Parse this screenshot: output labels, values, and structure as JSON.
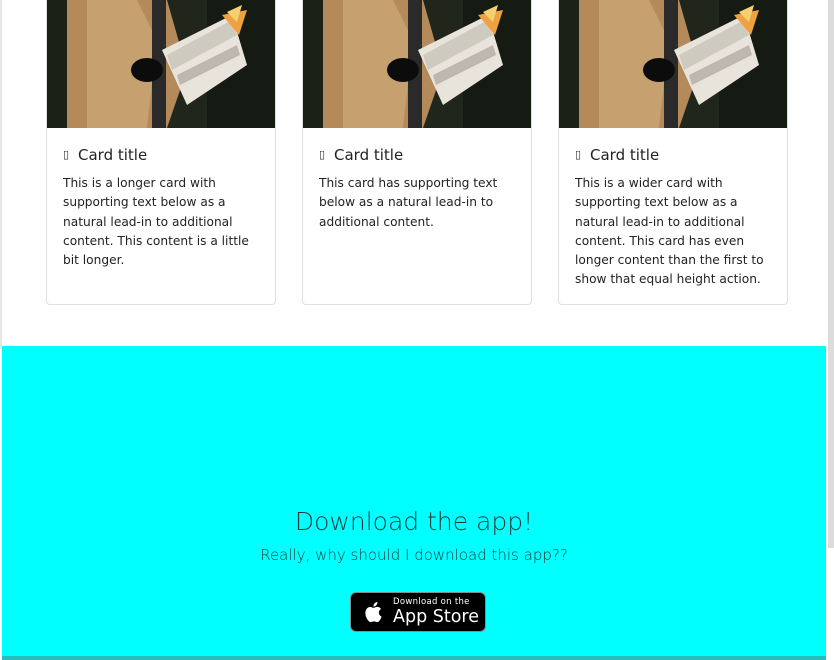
{
  "cards": [
    {
      "title": "Card title",
      "text": "This is a longer card with supporting text below as a natural lead-in to additional content. This content is a little bit longer."
    },
    {
      "title": "Card title",
      "text": "This card has supporting text below as a natural lead-in to additional content."
    },
    {
      "title": "Card title",
      "text": "This is a wider card with supporting text below as a natural lead-in to additional content. This card has even longer content than the first to show that equal height action."
    }
  ],
  "hero": {
    "title": "Download the app!",
    "subtitle": "Really, why should I download this app??",
    "button_small": "Download on the",
    "button_big": "App Store"
  },
  "colors": {
    "hero_background": "#00ffff",
    "button_background": "#000000"
  },
  "icons": {
    "card_title_icon": "card-title-icon",
    "store_icon": "apple-icon"
  }
}
